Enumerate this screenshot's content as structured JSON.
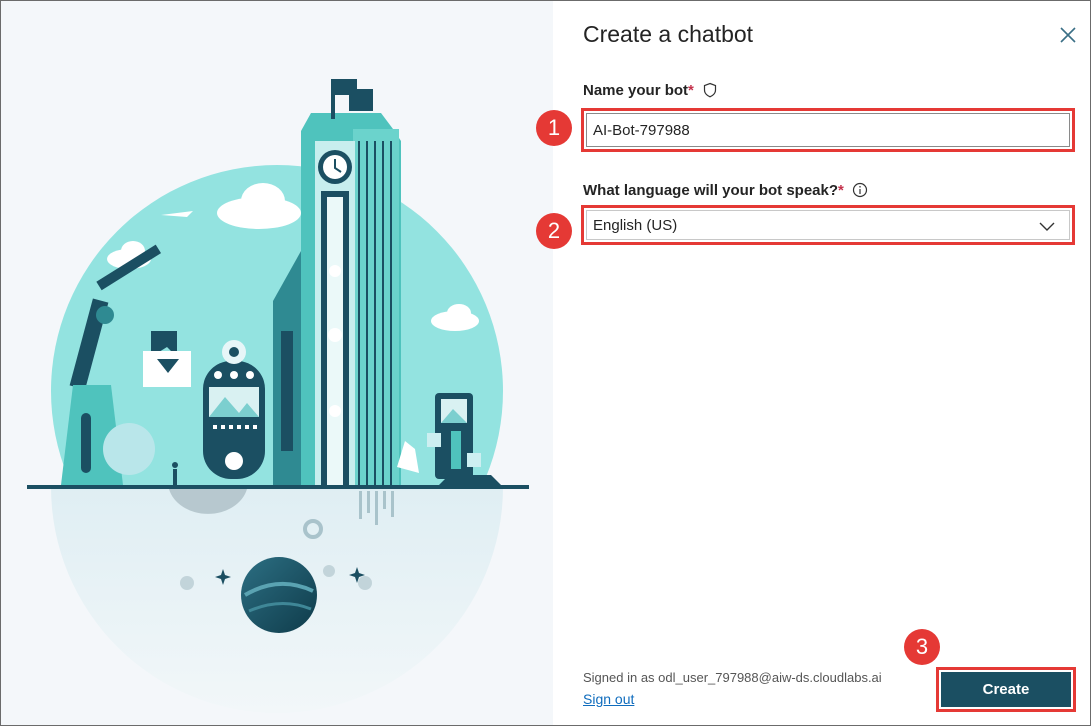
{
  "dialog": {
    "title": "Create a chatbot",
    "close_icon": "close-icon"
  },
  "form": {
    "name_label": "Name your bot",
    "name_required": "*",
    "name_value": "AI-Bot-797988",
    "language_label": "What language will your bot speak?",
    "language_required": "*",
    "language_value": "English (US)"
  },
  "callouts": [
    "1",
    "2",
    "3"
  ],
  "footer": {
    "signed_in_text": "Signed in as odl_user_797988@aiw-ds.cloudlabs.ai",
    "sign_out_label": "Sign out",
    "create_label": "Create"
  },
  "colors": {
    "accent": "#1b4f62",
    "highlight": "#e53935",
    "link": "#0f6cbd"
  }
}
